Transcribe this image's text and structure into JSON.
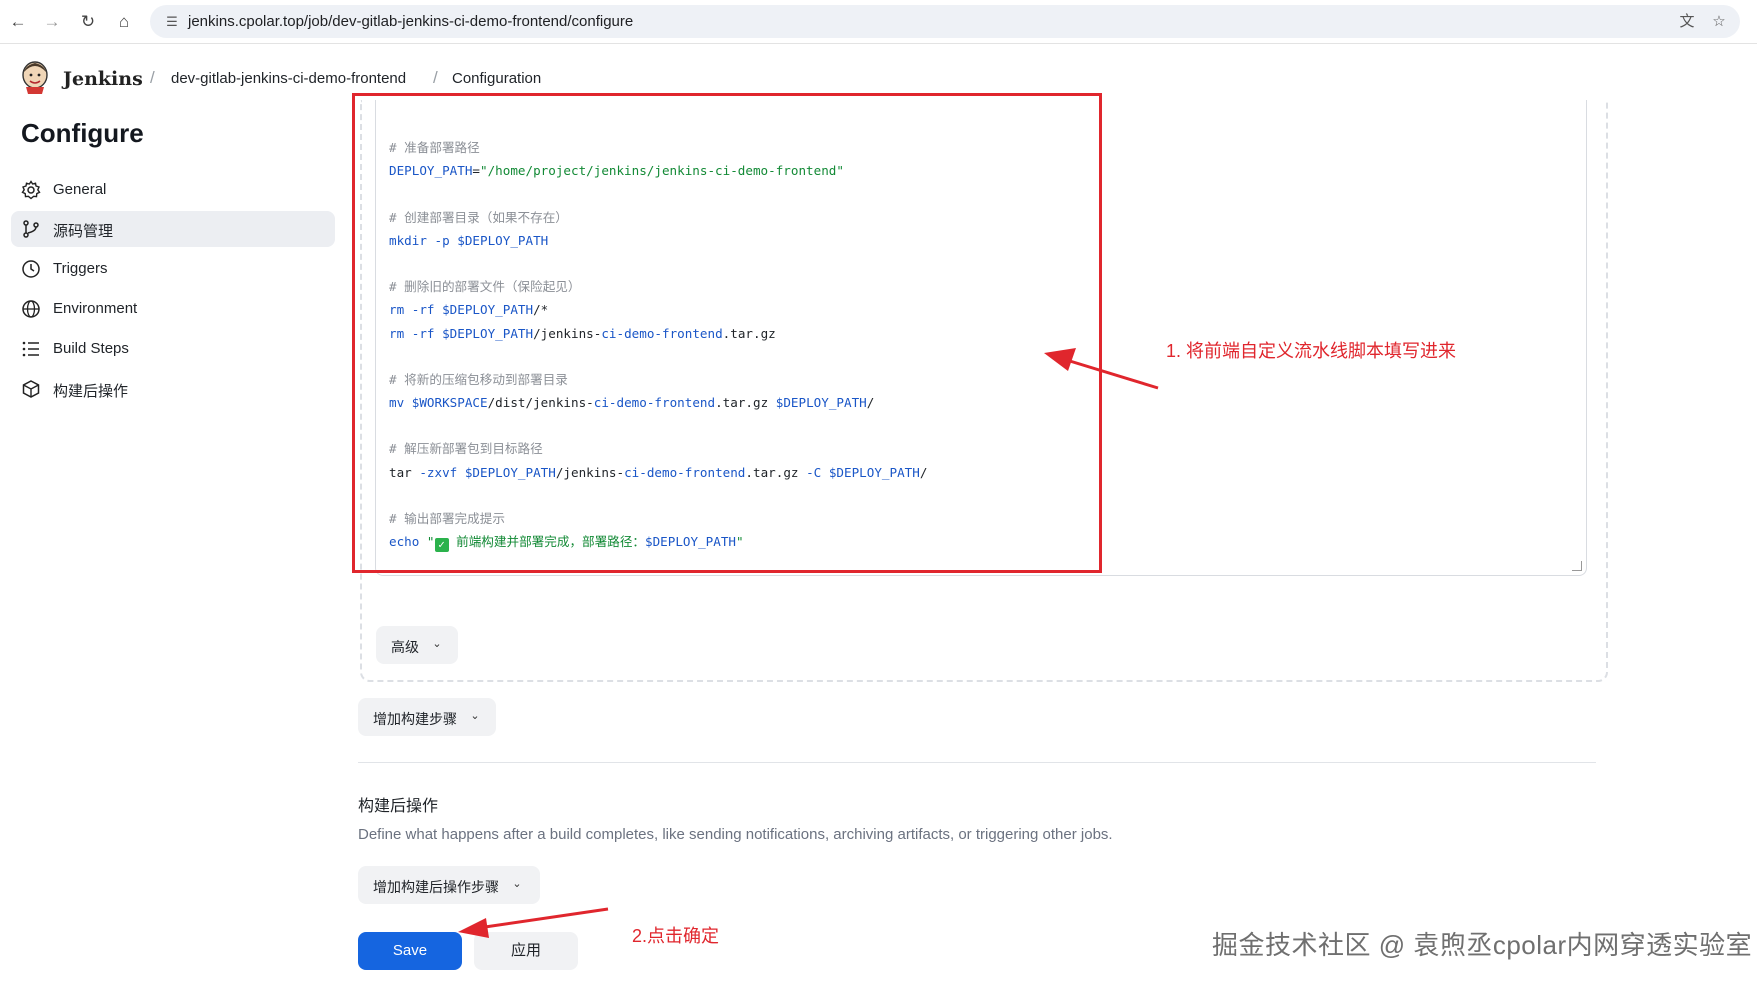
{
  "browser": {
    "url": "jenkins.cpolar.top/job/dev-gitlab-jenkins-ci-demo-frontend/configure"
  },
  "header": {
    "app_name": "Jenkins",
    "breadcrumbs": [
      "dev-gitlab-jenkins-ci-demo-frontend",
      "Configuration"
    ]
  },
  "sidebar": {
    "title": "Configure",
    "items": [
      {
        "label": "General",
        "icon": "gear-icon"
      },
      {
        "label": "源码管理",
        "icon": "git-branch-icon",
        "active": true
      },
      {
        "label": "Triggers",
        "icon": "clock-icon"
      },
      {
        "label": "Environment",
        "icon": "globe-icon"
      },
      {
        "label": "Build Steps",
        "icon": "list-icon"
      },
      {
        "label": "构建后操作",
        "icon": "cube-icon"
      }
    ]
  },
  "script": {
    "lines": [
      [
        {
          "t": "# 准备部署路径",
          "c": "cm"
        }
      ],
      [
        {
          "t": "DEPLOY_PATH",
          "c": "var"
        },
        {
          "t": "=",
          "c": "tx"
        },
        {
          "t": "\"/home/project/jenkins/jenkins-ci-demo-frontend\"",
          "c": "str"
        }
      ],
      [],
      [
        {
          "t": "# 创建部署目录（如果不存在）",
          "c": "cm"
        }
      ],
      [
        {
          "t": "mkdir",
          "c": "kw"
        },
        {
          "t": " -p ",
          "c": "kw"
        },
        {
          "t": "$DEPLOY_PATH",
          "c": "var"
        }
      ],
      [],
      [
        {
          "t": "# 删除旧的部署文件（保险起见）",
          "c": "cm"
        }
      ],
      [
        {
          "t": "rm",
          "c": "kw"
        },
        {
          "t": " -rf ",
          "c": "kw"
        },
        {
          "t": "$DEPLOY_PATH",
          "c": "var"
        },
        {
          "t": "/*",
          "c": "tx"
        }
      ],
      [
        {
          "t": "rm",
          "c": "kw"
        },
        {
          "t": " -rf ",
          "c": "kw"
        },
        {
          "t": "$DEPLOY_PATH",
          "c": "var"
        },
        {
          "t": "/jenkins-",
          "c": "tx"
        },
        {
          "t": "ci-demo-frontend",
          "c": "kw"
        },
        {
          "t": ".tar.gz",
          "c": "tx"
        }
      ],
      [],
      [
        {
          "t": "# 将新的压缩包移动到部署目录",
          "c": "cm"
        }
      ],
      [
        {
          "t": "mv",
          "c": "kw"
        },
        {
          "t": " ",
          "c": "tx"
        },
        {
          "t": "$WORKSPACE",
          "c": "var"
        },
        {
          "t": "/dist/jenkins-",
          "c": "tx"
        },
        {
          "t": "ci-demo-frontend",
          "c": "kw"
        },
        {
          "t": ".tar.gz ",
          "c": "tx"
        },
        {
          "t": "$DEPLOY_PATH",
          "c": "var"
        },
        {
          "t": "/",
          "c": "tx"
        }
      ],
      [],
      [
        {
          "t": "# 解压新部署包到目标路径",
          "c": "cm"
        }
      ],
      [
        {
          "t": "tar",
          "c": "tx"
        },
        {
          "t": " -zxvf ",
          "c": "kw"
        },
        {
          "t": "$DEPLOY_PATH",
          "c": "var"
        },
        {
          "t": "/jenkins-",
          "c": "tx"
        },
        {
          "t": "ci-demo-frontend",
          "c": "kw"
        },
        {
          "t": ".tar.gz",
          "c": "tx"
        },
        {
          "t": " -C ",
          "c": "kw"
        },
        {
          "t": "$DEPLOY_PATH",
          "c": "var"
        },
        {
          "t": "/",
          "c": "tx"
        }
      ],
      [],
      [
        {
          "t": "# 输出部署完成提示",
          "c": "cm"
        }
      ],
      [
        {
          "t": "echo",
          "c": "kw"
        },
        {
          "t": " \"",
          "c": "str"
        },
        {
          "t": "✓",
          "c": "check"
        },
        {
          "t": " 前端构建并部署完成，部署路径：",
          "c": "str"
        },
        {
          "t": "$DEPLOY_PATH",
          "c": "var"
        },
        {
          "t": "\"",
          "c": "str"
        }
      ]
    ]
  },
  "buttons": {
    "advanced": "高级",
    "add_build_step": "增加构建步骤",
    "add_post_build_step": "增加构建后操作步骤",
    "save": "Save",
    "apply": "应用"
  },
  "post_build": {
    "title": "构建后操作",
    "description": "Define what happens after a build completes, like sending notifications, archiving artifacts, or triggering other jobs."
  },
  "annotations": {
    "note1": "1. 将前端自定义流水线脚本填写进来",
    "note2": "2.点击确定",
    "accent": "#e0262d"
  },
  "watermark": "掘金技术社区 @ 袁煦丞cpolar内网穿透实验室"
}
